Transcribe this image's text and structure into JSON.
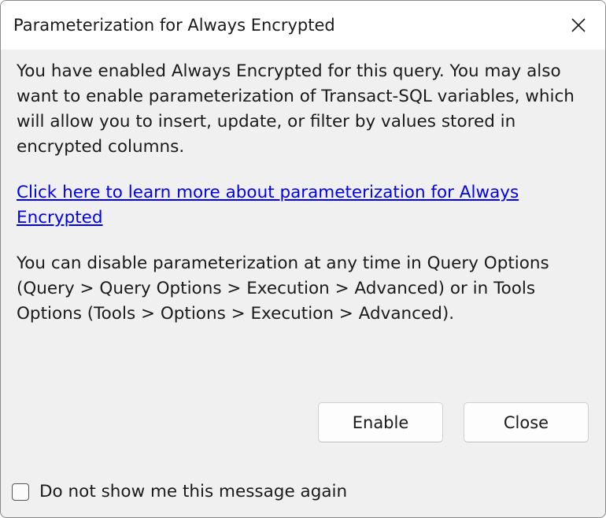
{
  "window": {
    "title": "Parameterization for Always Encrypted",
    "close_icon": "close-icon"
  },
  "message": {
    "intro": "You have enabled Always Encrypted for this query. You may also want to enable parameterization of Transact-SQL variables, which will allow you to insert, update, or filter by values stored in encrypted columns.",
    "link": "Click here to learn more about parameterization for Always Encrypted",
    "disable_info": "You can disable parameterization at any time in Query Options (Query > Query Options > Execution > Advanced) or in Tools Options (Tools > Options > Execution > Advanced)."
  },
  "buttons": {
    "enable": "Enable",
    "close": "Close"
  },
  "checkbox": {
    "label": "Do not show me this message again",
    "checked": false
  },
  "colors": {
    "link": "#0000ee",
    "background": "#f0f0f0",
    "titlebar": "#ffffff"
  }
}
